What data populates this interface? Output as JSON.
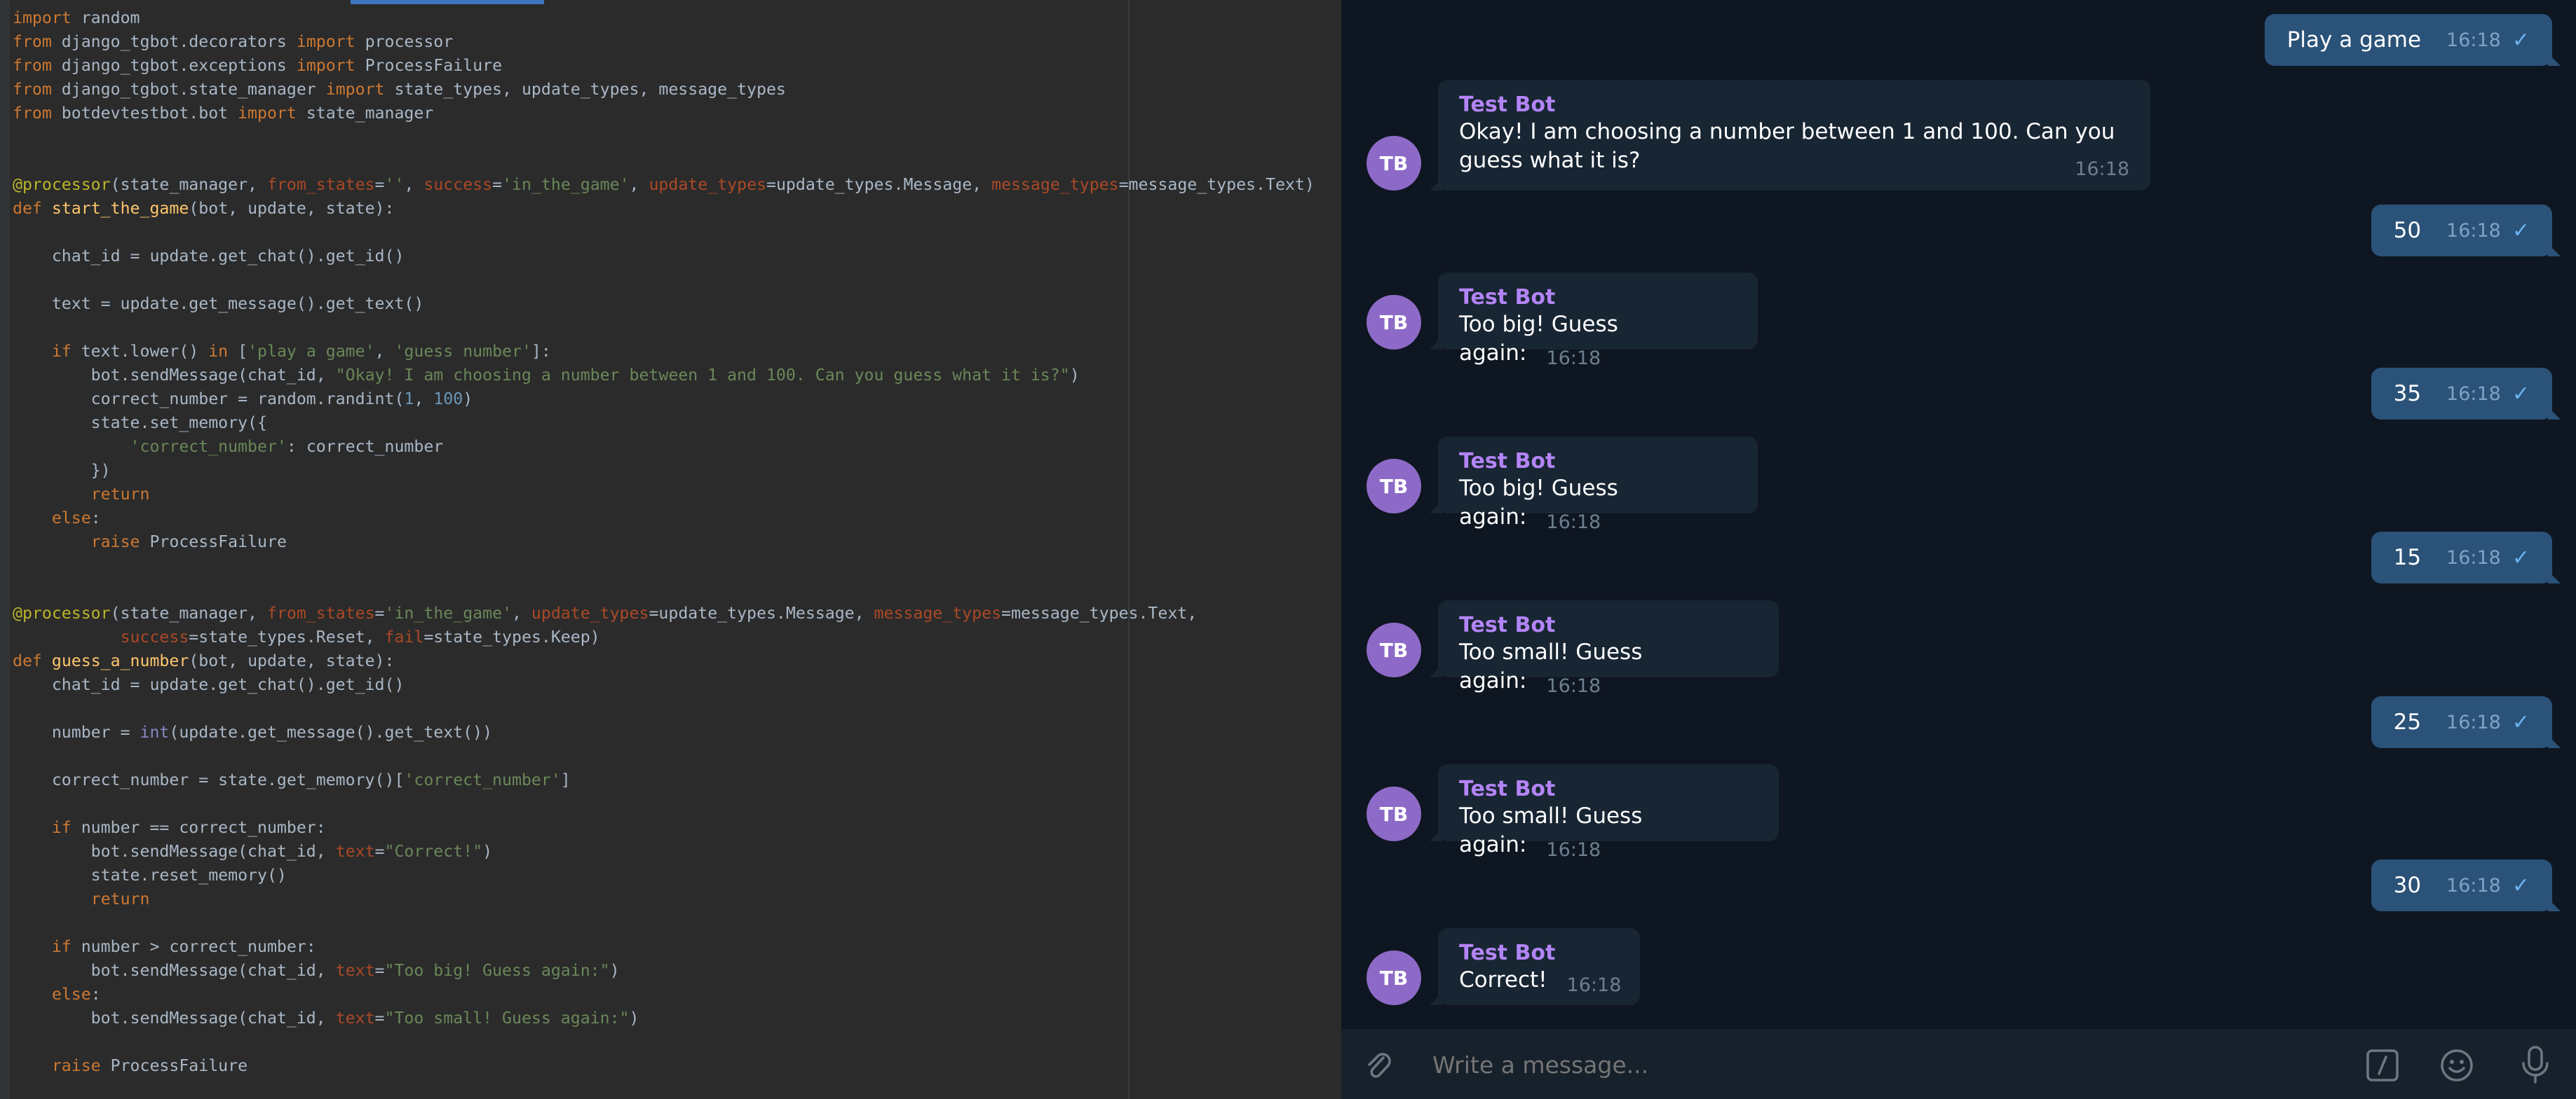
{
  "editor": {
    "lines": [
      [
        [
          "kw",
          "import"
        ],
        [
          "plain",
          " random"
        ]
      ],
      [
        [
          "kw",
          "from"
        ],
        [
          "plain",
          " django_tgbot.decorators "
        ],
        [
          "kw",
          "import"
        ],
        [
          "plain",
          " processor"
        ]
      ],
      [
        [
          "kw",
          "from"
        ],
        [
          "plain",
          " django_tgbot.exceptions "
        ],
        [
          "kw",
          "import"
        ],
        [
          "plain",
          " ProcessFailure"
        ]
      ],
      [
        [
          "kw",
          "from"
        ],
        [
          "plain",
          " django_tgbot.state_manager "
        ],
        [
          "kw",
          "import"
        ],
        [
          "plain",
          " state_types, update_types, message_types"
        ]
      ],
      [
        [
          "kw",
          "from"
        ],
        [
          "plain",
          " botdevtestbot.bot "
        ],
        [
          "kw",
          "import"
        ],
        [
          "plain",
          " state_manager"
        ]
      ],
      [],
      [],
      [
        [
          "dec",
          "@processor"
        ],
        [
          "plain",
          "(state_manager, "
        ],
        [
          "par",
          "from_states"
        ],
        [
          "plain",
          "="
        ],
        [
          "str",
          "''"
        ],
        [
          "plain",
          ", "
        ],
        [
          "par",
          "success"
        ],
        [
          "plain",
          "="
        ],
        [
          "str",
          "'in_the_game'"
        ],
        [
          "plain",
          ", "
        ],
        [
          "par",
          "update_types"
        ],
        [
          "plain",
          "=update_types.Message, "
        ],
        [
          "par",
          "message_types"
        ],
        [
          "plain",
          "=message_types.Text)"
        ]
      ],
      [
        [
          "kw",
          "def"
        ],
        [
          "plain",
          " "
        ],
        [
          "fn",
          "start_the_game"
        ],
        [
          "plain",
          "(bot, update, state):"
        ]
      ],
      [],
      [
        [
          "plain",
          "    chat_id = update.get_chat().get_id()"
        ]
      ],
      [],
      [
        [
          "plain",
          "    text = update.get_message().get_text()"
        ]
      ],
      [],
      [
        [
          "plain",
          "    "
        ],
        [
          "kw",
          "if"
        ],
        [
          "plain",
          " text.lower() "
        ],
        [
          "kw",
          "in"
        ],
        [
          "plain",
          " ["
        ],
        [
          "str",
          "'play a game'"
        ],
        [
          "plain",
          ", "
        ],
        [
          "str",
          "'guess number'"
        ],
        [
          "plain",
          "]:"
        ]
      ],
      [
        [
          "plain",
          "        bot.sendMessage(chat_id, "
        ],
        [
          "str",
          "\"Okay! I am choosing a number between 1 and 100. Can you guess what it is?\""
        ],
        [
          "plain",
          ")"
        ]
      ],
      [
        [
          "plain",
          "        correct_number = random.randint("
        ],
        [
          "num",
          "1"
        ],
        [
          "plain",
          ", "
        ],
        [
          "num",
          "100"
        ],
        [
          "plain",
          ")"
        ]
      ],
      [
        [
          "plain",
          "        state.set_memory({"
        ]
      ],
      [
        [
          "plain",
          "            "
        ],
        [
          "str",
          "'correct_number'"
        ],
        [
          "plain",
          ": correct_number"
        ]
      ],
      [
        [
          "plain",
          "        })"
        ]
      ],
      [
        [
          "plain",
          "        "
        ],
        [
          "kw",
          "return"
        ]
      ],
      [
        [
          "plain",
          "    "
        ],
        [
          "kw",
          "else"
        ],
        [
          "plain",
          ":"
        ]
      ],
      [
        [
          "plain",
          "        "
        ],
        [
          "kw",
          "raise"
        ],
        [
          "plain",
          " ProcessFailure"
        ]
      ],
      [],
      [],
      [
        [
          "dec",
          "@processor"
        ],
        [
          "plain",
          "(state_manager, "
        ],
        [
          "par",
          "from_states"
        ],
        [
          "plain",
          "="
        ],
        [
          "str",
          "'in_the_game'"
        ],
        [
          "plain",
          ", "
        ],
        [
          "par",
          "update_types"
        ],
        [
          "plain",
          "=update_types.Message, "
        ],
        [
          "par",
          "message_types"
        ],
        [
          "plain",
          "=message_types.Text,"
        ]
      ],
      [
        [
          "plain",
          "           "
        ],
        [
          "par",
          "success"
        ],
        [
          "plain",
          "=state_types.Reset, "
        ],
        [
          "par",
          "fail"
        ],
        [
          "plain",
          "=state_types.Keep)"
        ]
      ],
      [
        [
          "kw",
          "def"
        ],
        [
          "plain",
          " "
        ],
        [
          "fn",
          "guess_a_number"
        ],
        [
          "plain",
          "(bot, update, state):"
        ]
      ],
      [
        [
          "plain",
          "    chat_id = update.get_chat().get_id()"
        ]
      ],
      [],
      [
        [
          "plain",
          "    number = "
        ],
        [
          "builtin",
          "int"
        ],
        [
          "plain",
          "(update.get_message().get_text())"
        ]
      ],
      [],
      [
        [
          "plain",
          "    correct_number = state.get_memory()["
        ],
        [
          "str",
          "'correct_number'"
        ],
        [
          "plain",
          "]"
        ]
      ],
      [],
      [
        [
          "plain",
          "    "
        ],
        [
          "kw",
          "if"
        ],
        [
          "plain",
          " number == correct_number:"
        ]
      ],
      [
        [
          "plain",
          "        bot.sendMessage(chat_id, "
        ],
        [
          "par",
          "text"
        ],
        [
          "plain",
          "="
        ],
        [
          "str",
          "\"Correct!\""
        ],
        [
          "plain",
          ")"
        ]
      ],
      [
        [
          "plain",
          "        state.reset_memory()"
        ]
      ],
      [
        [
          "plain",
          "        "
        ],
        [
          "kw",
          "return"
        ]
      ],
      [],
      [
        [
          "plain",
          "    "
        ],
        [
          "kw",
          "if"
        ],
        [
          "plain",
          " number > correct_number:"
        ]
      ],
      [
        [
          "plain",
          "        bot.sendMessage(chat_id, "
        ],
        [
          "par",
          "text"
        ],
        [
          "plain",
          "="
        ],
        [
          "str",
          "\"Too big! Guess again:\""
        ],
        [
          "plain",
          ")"
        ]
      ],
      [
        [
          "plain",
          "    "
        ],
        [
          "kw",
          "else"
        ],
        [
          "plain",
          ":"
        ]
      ],
      [
        [
          "plain",
          "        bot.sendMessage(chat_id, "
        ],
        [
          "par",
          "text"
        ],
        [
          "plain",
          "="
        ],
        [
          "str",
          "\"Too small! Guess again:\""
        ],
        [
          "plain",
          ")"
        ]
      ],
      [],
      [
        [
          "plain",
          "    "
        ],
        [
          "kw",
          "raise"
        ],
        [
          "plain",
          " ProcessFailure"
        ]
      ]
    ]
  },
  "chat": {
    "messages": [
      {
        "dir": "out",
        "text": "Play a game",
        "time": "16:18"
      },
      {
        "dir": "in",
        "avatar": "TB",
        "sender": "Test Bot",
        "text": "Okay! I am choosing a number between 1 and 100. Can you guess what it is?",
        "time": "16:18"
      },
      {
        "dir": "out",
        "text": "50",
        "time": "16:18"
      },
      {
        "dir": "in",
        "avatar": "TB",
        "sender": "Test Bot",
        "text": "Too big! Guess again:",
        "time": "16:18"
      },
      {
        "dir": "out",
        "text": "35",
        "time": "16:18"
      },
      {
        "dir": "in",
        "avatar": "TB",
        "sender": "Test Bot",
        "text": "Too big! Guess again:",
        "time": "16:18"
      },
      {
        "dir": "out",
        "text": "15",
        "time": "16:18"
      },
      {
        "dir": "in",
        "avatar": "TB",
        "sender": "Test Bot",
        "text": "Too small! Guess again:",
        "time": "16:18"
      },
      {
        "dir": "out",
        "text": "25",
        "time": "16:18"
      },
      {
        "dir": "in",
        "avatar": "TB",
        "sender": "Test Bot",
        "text": "Too small! Guess again:",
        "time": "16:18"
      },
      {
        "dir": "out",
        "text": "30",
        "time": "16:18"
      },
      {
        "dir": "in",
        "avatar": "TB",
        "sender": "Test Bot",
        "text": "Correct!",
        "time": "16:18"
      }
    ],
    "composer": {
      "placeholder": "Write a message...",
      "icons": [
        "paperclip-icon",
        "bot-command-icon",
        "emoji-icon",
        "microphone-icon"
      ]
    }
  }
}
